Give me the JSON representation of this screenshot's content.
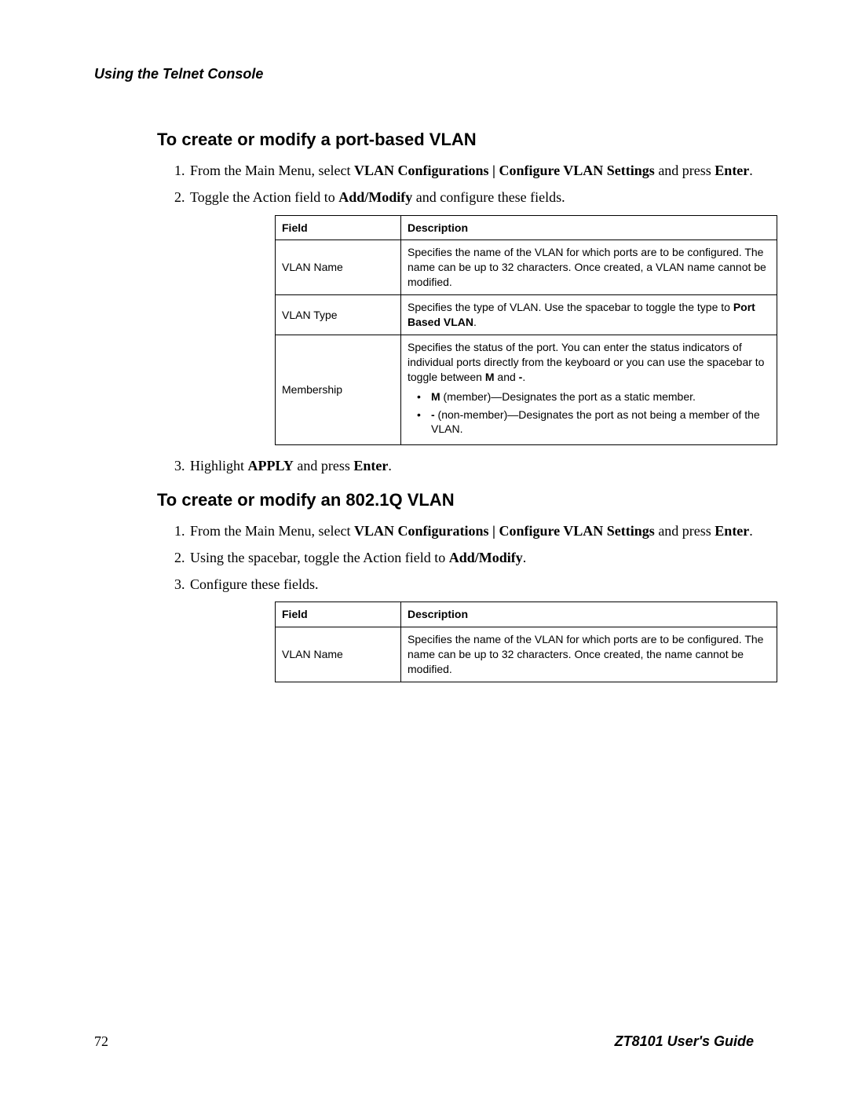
{
  "header": {
    "running_head": "Using the Telnet Console"
  },
  "sectionA": {
    "title": "To create or modify a port-based VLAN",
    "steps": {
      "s1": {
        "pre": "From the Main Menu, select ",
        "bold1": "VLAN Configurations | Configure VLAN Settings",
        "mid": " and press ",
        "bold2": "Enter",
        "post": "."
      },
      "s2": {
        "pre": "Toggle the Action field to ",
        "bold1": "Add/Modify",
        "post": " and configure these fields."
      },
      "s3": {
        "pre": "Highlight ",
        "bold1": "APPLY",
        "mid": " and press ",
        "bold2": "Enter",
        "post": "."
      }
    },
    "table": {
      "head_field": "Field",
      "head_desc": "Description",
      "rows": {
        "r1": {
          "field": "VLAN Name",
          "desc": "Specifies the name of the VLAN for which ports are to be configured. The name can be up to 32 characters. Once created, a VLAN name cannot be modified."
        },
        "r2": {
          "field": "VLAN Type",
          "desc_pre": "Specifies the type of VLAN. Use the spacebar to toggle the type to ",
          "desc_bold": "Port Based VLAN",
          "desc_post": "."
        },
        "r3": {
          "field": "Membership",
          "intro_pre": "Specifies the status of the port. You can enter the status indicators of individual ports directly from the keyboard or you can use the spacebar to toggle between ",
          "intro_b1": "M",
          "intro_mid": " and ",
          "intro_b2": "-",
          "intro_post": ".",
          "b1_bold": "M",
          "b1_rest": " (member)—Designates the port as a static member.",
          "b2_bold": "-",
          "b2_rest": " (non-member)—Designates the port as not being a member of the VLAN."
        }
      }
    }
  },
  "sectionB": {
    "title": "To create or modify an 802.1Q VLAN",
    "steps": {
      "s1": {
        "pre": "From the Main Menu, select ",
        "bold1": "VLAN Configurations | Configure VLAN Settings",
        "mid": " and press ",
        "bold2": "Enter",
        "post": "."
      },
      "s2": {
        "pre": "Using the spacebar, toggle the Action field to ",
        "bold1": "Add/Modify",
        "post": "."
      },
      "s3": {
        "text": "Configure these fields."
      }
    },
    "table": {
      "head_field": "Field",
      "head_desc": "Description",
      "rows": {
        "r1": {
          "field": "VLAN Name",
          "desc": "Specifies the name of the VLAN for which ports are to be configured. The name can be up to 32 characters. Once created, the name cannot be modified."
        }
      }
    }
  },
  "footer": {
    "page": "72",
    "guide": "ZT8101 User's Guide"
  }
}
